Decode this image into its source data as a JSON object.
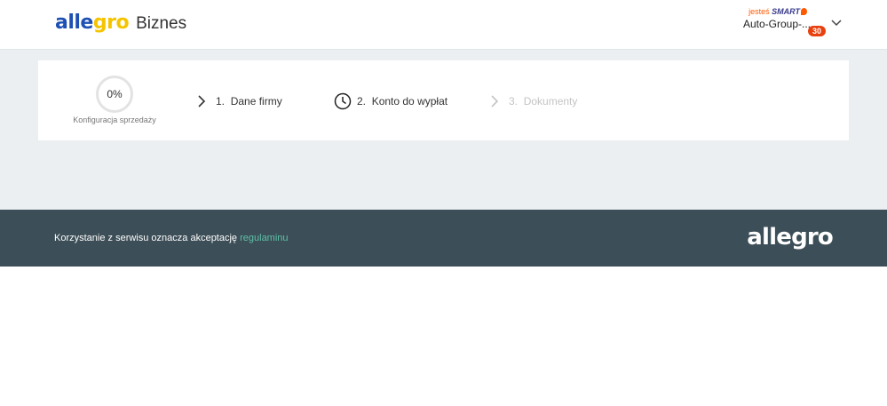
{
  "header": {
    "logo": {
      "part1": "alle",
      "part2": "gro",
      "suffix": "Biznes"
    },
    "account": {
      "smart_prefix": "jesteś",
      "smart_label": "SMART",
      "name": "Auto-Group-...",
      "badge": "30"
    }
  },
  "setup": {
    "progress_value": "0%",
    "progress_label": "Konfiguracja sprzedaży",
    "steps": [
      {
        "number": "1.",
        "label": "Dane firmy",
        "icon": "chevron-right-icon",
        "state": "active"
      },
      {
        "number": "2.",
        "label": "Konto do wypłat",
        "icon": "clock-icon",
        "state": "pending"
      },
      {
        "number": "3.",
        "label": "Dokumenty",
        "icon": "chevron-right-icon",
        "state": "disabled"
      }
    ]
  },
  "footer": {
    "text": "Korzystanie z serwisu oznacza akceptację",
    "link": "regulaminu",
    "logo": "allegro"
  },
  "colors": {
    "brand_blue": "#1e50b4",
    "brand_yellow": "#f5c400",
    "accent_orange": "#ff5a00",
    "footer_bg": "#3c4e57",
    "footer_link": "#5fc0a8",
    "page_bg": "#eceff2"
  }
}
